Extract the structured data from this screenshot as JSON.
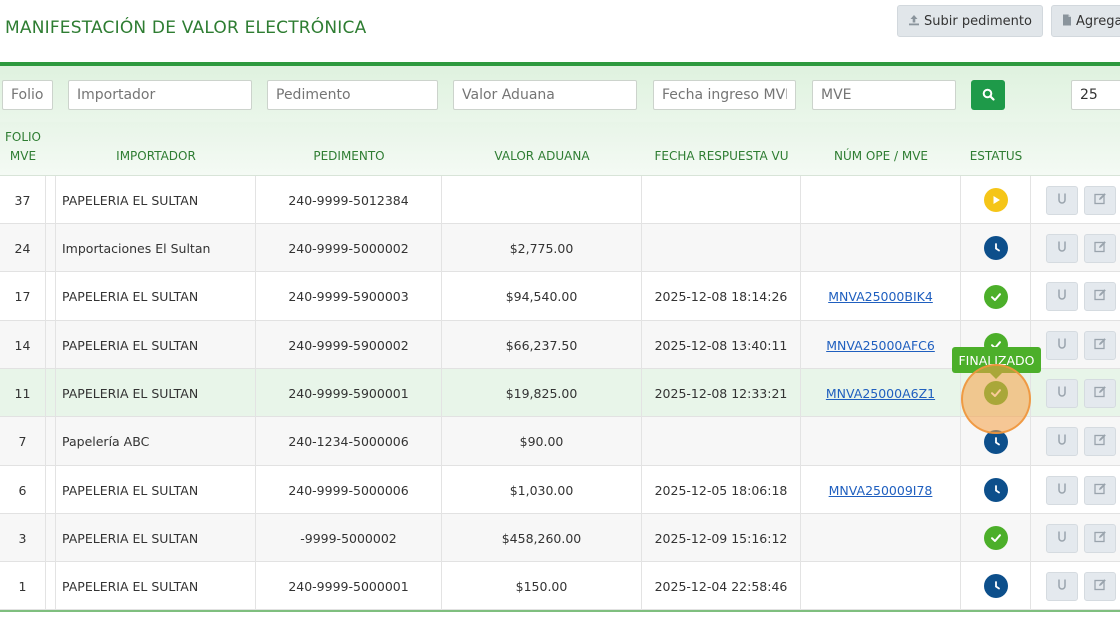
{
  "header": {
    "title": "MANIFESTACIÓN DE VALOR ELECTRÓNICA",
    "upload_label": "Subir pedimento",
    "add_label": "Agregar"
  },
  "filters": {
    "folio": "Folio",
    "importador": "Importador",
    "pedimento": "Pedimento",
    "valor_aduana": "Valor Aduana",
    "fecha_ingreso": "Fecha ingreso MVE",
    "mve": "MVE",
    "page_size": "25"
  },
  "columns": {
    "folio_line1": "FOLIO",
    "folio_line2": "MVE",
    "importador": "IMPORTADOR",
    "pedimento": "PEDIMENTO",
    "valor_aduana": "VALOR ADUANA",
    "fecha_respuesta": "FECHA RESPUESTA VU",
    "num_ope": "NÚM OPE / MVE",
    "estatus": "ESTATUS"
  },
  "rows": [
    {
      "folio": "37",
      "importador": "PAPELERIA EL SULTAN",
      "pedimento": "240-9999-5012384",
      "valor": "",
      "fecha": "",
      "numope": "",
      "status": "play"
    },
    {
      "folio": "24",
      "importador": "Importaciones El Sultan",
      "pedimento": "240-9999-5000002",
      "valor": "$2,775.00",
      "fecha": "",
      "numope": "",
      "status": "clock"
    },
    {
      "folio": "17",
      "importador": "PAPELERIA EL SULTAN",
      "pedimento": "240-9999-5900003",
      "valor": "$94,540.00",
      "fecha": "2025-12-08 18:14:26",
      "numope": "MNVA25000BIK4",
      "status": "check"
    },
    {
      "folio": "14",
      "importador": "PAPELERIA EL SULTAN",
      "pedimento": "240-9999-5900002",
      "valor": "$66,237.50",
      "fecha": "2025-12-08 13:40:11",
      "numope": "MNVA25000AFC6",
      "status": "check"
    },
    {
      "folio": "11",
      "importador": "PAPELERIA EL SULTAN",
      "pedimento": "240-9999-5900001",
      "valor": "$19,825.00",
      "fecha": "2025-12-08 12:33:21",
      "numope": "MNVA25000A6Z1",
      "status": "check"
    },
    {
      "folio": "7",
      "importador": "Papelería ABC",
      "pedimento": "240-1234-5000006",
      "valor": "$90.00",
      "fecha": "",
      "numope": "",
      "status": "clock"
    },
    {
      "folio": "6",
      "importador": "PAPELERIA EL SULTAN",
      "pedimento": "240-9999-5000006",
      "valor": "$1,030.00",
      "fecha": "2025-12-05 18:06:18",
      "numope": "MNVA250009I78",
      "status": "clock"
    },
    {
      "folio": "3",
      "importador": "PAPELERIA EL SULTAN",
      "pedimento": "-9999-5000002",
      "valor": "$458,260.00",
      "fecha": "2025-12-09 15:16:12",
      "numope": "",
      "status": "check"
    },
    {
      "folio": "1",
      "importador": "PAPELERIA EL SULTAN",
      "pedimento": "240-9999-5000001",
      "valor": "$150.00",
      "fecha": "2025-12-04 22:58:46",
      "numope": "",
      "status": "clock"
    }
  ],
  "tooltip": "FINALIZADO",
  "colors": {
    "accent": "#2e7d32",
    "success": "#4caf2a",
    "pending": "#f5c518",
    "processing": "#0d4f8b"
  }
}
